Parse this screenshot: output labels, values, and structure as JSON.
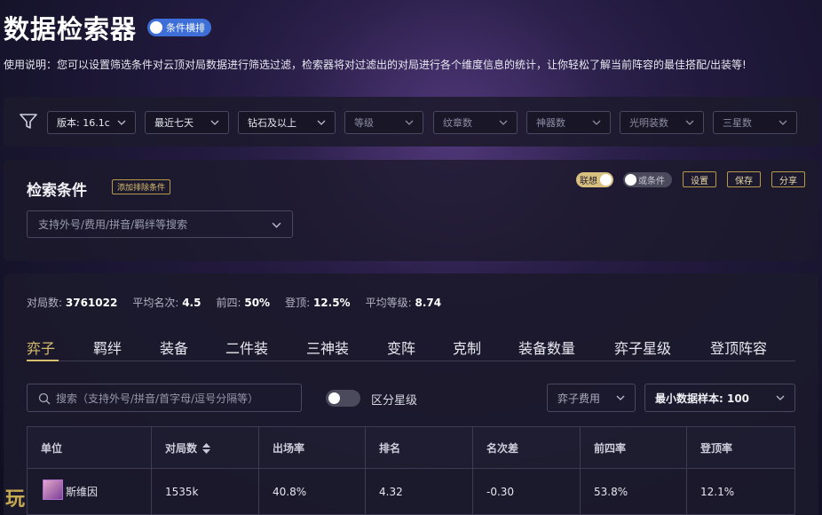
{
  "app": {
    "title": "数据检索器",
    "toggle_label": "条件横排"
  },
  "usage_text": "使用说明：您可以设置筛选条件对云顶对局数据进行筛选过滤，检索器将对过滤出的对局进行各个维度信息的统计，让你轻松了解当前阵容的最佳搭配/出装等!",
  "filters": {
    "version": "版本: 16.1c",
    "period": "最近七天",
    "rank": "钻石及以上",
    "level": "等级",
    "emblems": "纹章数",
    "artifacts": "神器数",
    "radiant": "光明装数",
    "three_star": "三星数"
  },
  "search_panel": {
    "title": "检索条件",
    "add_exclude": "添加排除条件",
    "toggle_assoc": "联想",
    "toggle_or": "或条件",
    "btn_settings": "设置",
    "btn_save": "保存",
    "btn_share": "分享",
    "input_placeholder": "支持外号/费用/拼音/羁绊等搜索"
  },
  "stats": {
    "games_label": "对局数:",
    "games": "3761022",
    "avg_label": "平均名次:",
    "avg": "4.5",
    "top4_label": "前四:",
    "top4": "50%",
    "top1_label": "登顶:",
    "top1": "12.5%",
    "avg_level_label": "平均等级:",
    "avg_level": "8.74"
  },
  "tabs": [
    "弈子",
    "羁绊",
    "装备",
    "二件装",
    "三神装",
    "变阵",
    "克制",
    "装备数量",
    "弈子星级",
    "登顶阵容"
  ],
  "table_controls": {
    "search_placeholder": "搜索（支持外号/拼音/首字母/逗号分隔等）",
    "star_label": "区分星级",
    "cost_dropdown": "弈子费用",
    "min_sample": "最小数据样本: 100"
  },
  "table": {
    "headers": [
      "单位",
      "对局数",
      "出场率",
      "排名",
      "名次差",
      "前四率",
      "登顶率"
    ],
    "rows": [
      {
        "unit": "斯维因",
        "games": "1535k",
        "pick_rate": "40.8%",
        "rank": "4.32",
        "diff": "-0.30",
        "top4": "53.8%",
        "top1": "12.1%"
      }
    ]
  },
  "watermark": "玩",
  "colors": {
    "accent_gold": "#d7bd6d",
    "toggle_blue": "#3e6fd8",
    "panel": "#1c1a2c"
  }
}
